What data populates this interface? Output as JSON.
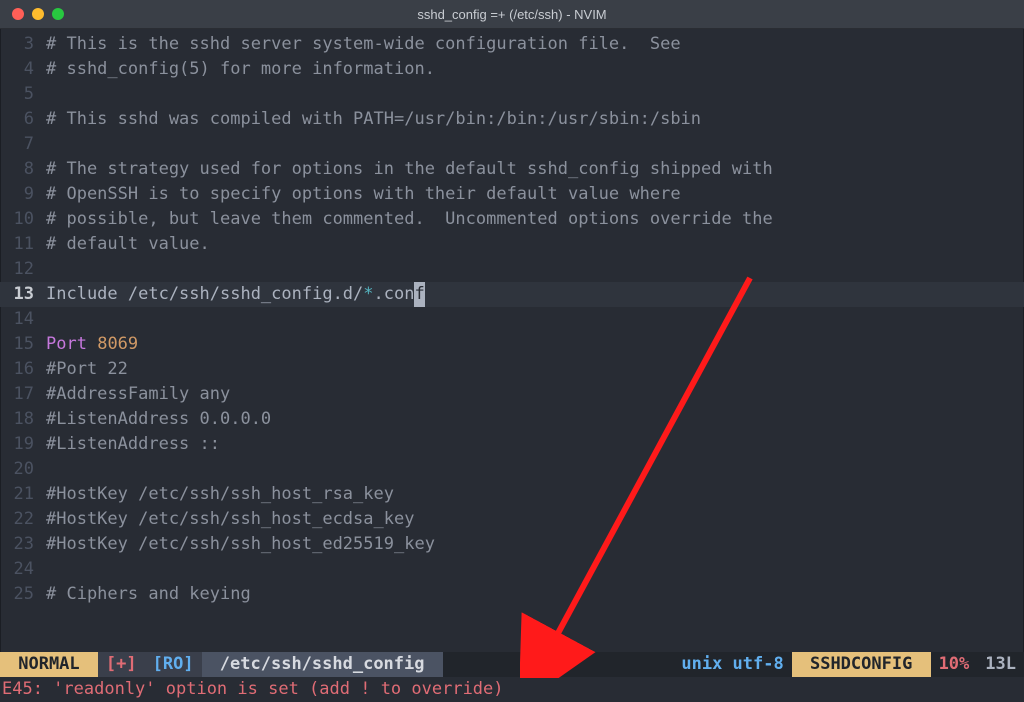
{
  "window": {
    "title": "sshd_config =+ (/etc/ssh) - NVIM"
  },
  "cursor_line_index": 10,
  "lines": [
    {
      "n": 3,
      "kind": "comment",
      "text": "# This is the sshd server system-wide configuration file.  See"
    },
    {
      "n": 4,
      "kind": "comment",
      "text": "# sshd_config(5) for more information."
    },
    {
      "n": 5,
      "kind": "blank",
      "text": ""
    },
    {
      "n": 6,
      "kind": "comment",
      "text": "# This sshd was compiled with PATH=/usr/bin:/bin:/usr/sbin:/sbin"
    },
    {
      "n": 7,
      "kind": "blank",
      "text": ""
    },
    {
      "n": 8,
      "kind": "comment",
      "text": "# The strategy used for options in the default sshd_config shipped with"
    },
    {
      "n": 9,
      "kind": "comment",
      "text": "# OpenSSH is to specify options with their default value where"
    },
    {
      "n": 10,
      "kind": "comment",
      "text": "# possible, but leave them commented.  Uncommented options override the"
    },
    {
      "n": 11,
      "kind": "comment",
      "text": "# default value."
    },
    {
      "n": 12,
      "kind": "blank",
      "text": ""
    },
    {
      "n": 13,
      "kind": "include",
      "pre": "Include /etc/ssh/sshd_config.d/",
      "glob": "*",
      "post": ".con",
      "cursor_char": "f"
    },
    {
      "n": 14,
      "kind": "blank",
      "text": ""
    },
    {
      "n": 15,
      "kind": "port",
      "key": "Port",
      "val": "8069"
    },
    {
      "n": 16,
      "kind": "comment",
      "text": "#Port 22"
    },
    {
      "n": 17,
      "kind": "comment",
      "text": "#AddressFamily any"
    },
    {
      "n": 18,
      "kind": "comment",
      "text": "#ListenAddress 0.0.0.0"
    },
    {
      "n": 19,
      "kind": "comment",
      "text": "#ListenAddress ::"
    },
    {
      "n": 20,
      "kind": "blank",
      "text": ""
    },
    {
      "n": 21,
      "kind": "comment",
      "text": "#HostKey /etc/ssh/ssh_host_rsa_key"
    },
    {
      "n": 22,
      "kind": "comment",
      "text": "#HostKey /etc/ssh/ssh_host_ecdsa_key"
    },
    {
      "n": 23,
      "kind": "comment",
      "text": "#HostKey /etc/ssh/ssh_host_ed25519_key"
    },
    {
      "n": 24,
      "kind": "blank",
      "text": ""
    },
    {
      "n": 25,
      "kind": "comment",
      "text": "# Ciphers and keying"
    }
  ],
  "status": {
    "mode": " NORMAL ",
    "modified": "[+]",
    "readonly": "[RO]",
    "file": " /etc/ssh/sshd_config ",
    "encoding": "unix utf-8",
    "filetype": " SSHDCONFIG ",
    "percent": "10%",
    "lines": "13L"
  },
  "cmdline": "E45: 'readonly' option is set (add ! to override)"
}
